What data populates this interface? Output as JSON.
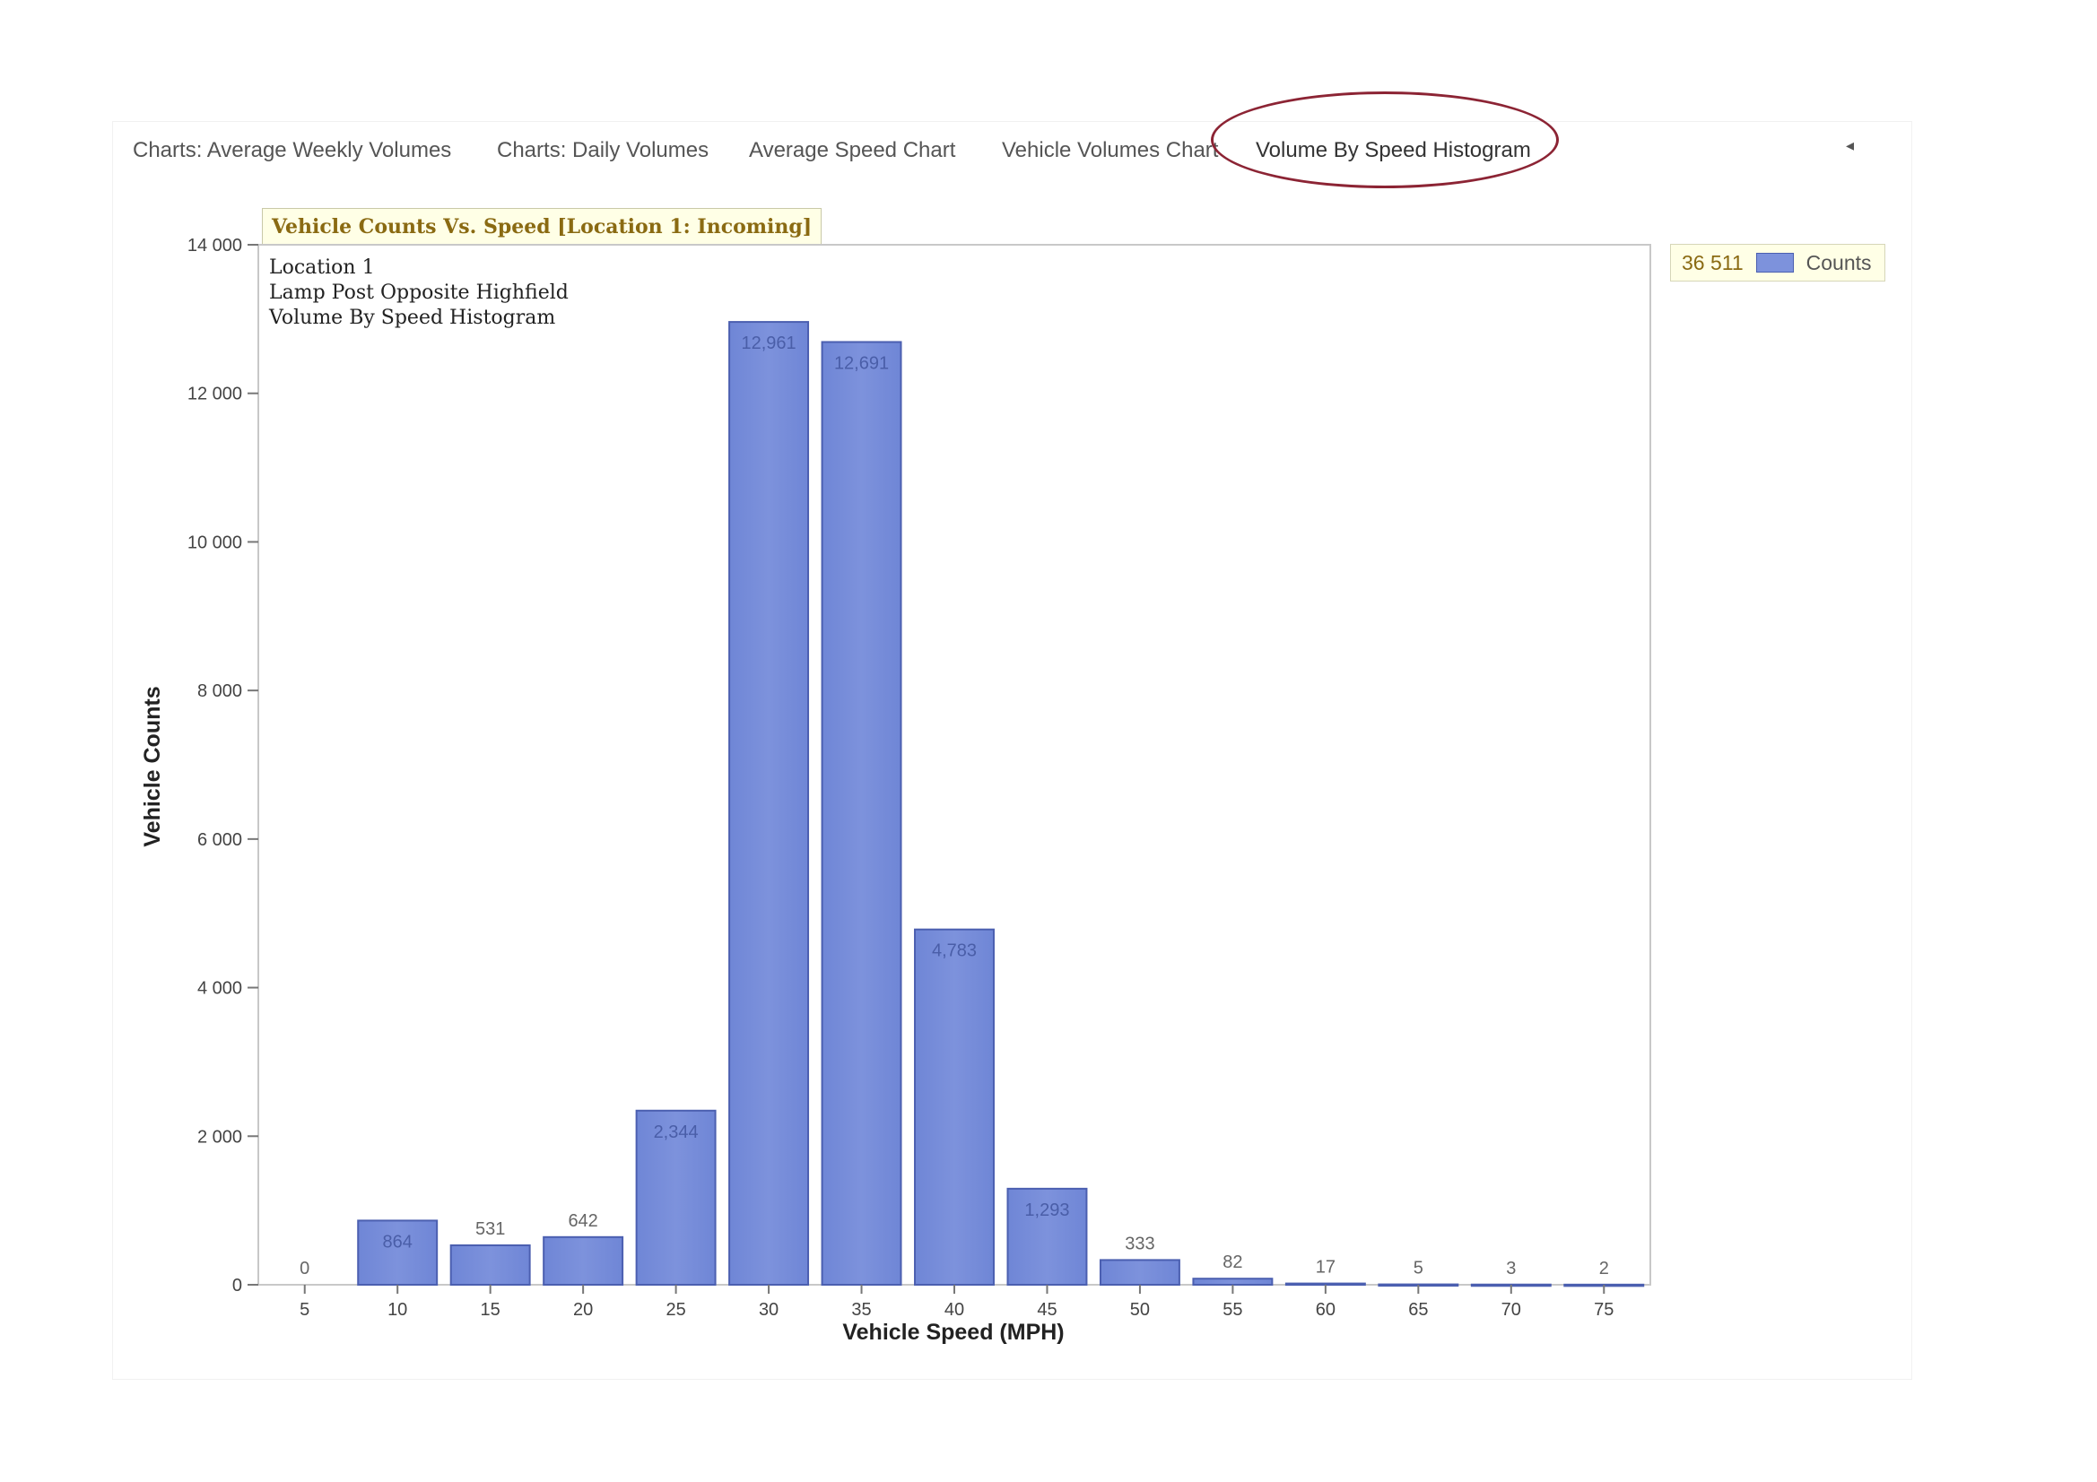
{
  "tabs": [
    {
      "label": "Charts: Average Weekly Volumes",
      "active": false
    },
    {
      "label": "Charts: Daily Volumes",
      "active": false
    },
    {
      "label": "Average Speed Chart",
      "active": false
    },
    {
      "label": "Vehicle Volumes Chart",
      "active": false
    },
    {
      "label": "Volume By Speed Histogram",
      "active": true
    }
  ],
  "tab_scroll_icon": "caret-left-icon",
  "legend": {
    "total": "36 511",
    "label": "Counts"
  },
  "info_lines": [
    "Location 1",
    "Lamp Post Opposite Highfield",
    "Volume By Speed Histogram"
  ],
  "colors": {
    "bar_fill": "#7d92dc",
    "bar_stroke": "#4b5fb0",
    "highlight_ring": "#8c2434"
  },
  "chart_data": {
    "type": "bar",
    "title": "Vehicle Counts Vs. Speed [Location 1: Incoming]",
    "xlabel": "Vehicle Speed (MPH)",
    "ylabel": "Vehicle Counts",
    "ylim": [
      0,
      14000
    ],
    "yticks": [
      0,
      2000,
      4000,
      6000,
      8000,
      10000,
      12000,
      14000
    ],
    "ytick_labels": [
      "0",
      "2 000",
      "4 000",
      "6 000",
      "8 000",
      "10 000",
      "12 000",
      "14 000"
    ],
    "grid": false,
    "legend_position": "top-right",
    "categories": [
      "5",
      "10",
      "15",
      "20",
      "25",
      "30",
      "35",
      "40",
      "45",
      "50",
      "55",
      "60",
      "65",
      "70",
      "75"
    ],
    "series": [
      {
        "name": "Counts",
        "values": [
          0,
          864,
          531,
          642,
          2344,
          12961,
          12691,
          4783,
          1293,
          333,
          82,
          17,
          5,
          3,
          2
        ],
        "labels": [
          "0",
          "864",
          "531",
          "642",
          "2,344",
          "12,961",
          "12,691",
          "4,783",
          "1,293",
          "333",
          "82",
          "17",
          "5",
          "3",
          "2"
        ]
      }
    ]
  }
}
